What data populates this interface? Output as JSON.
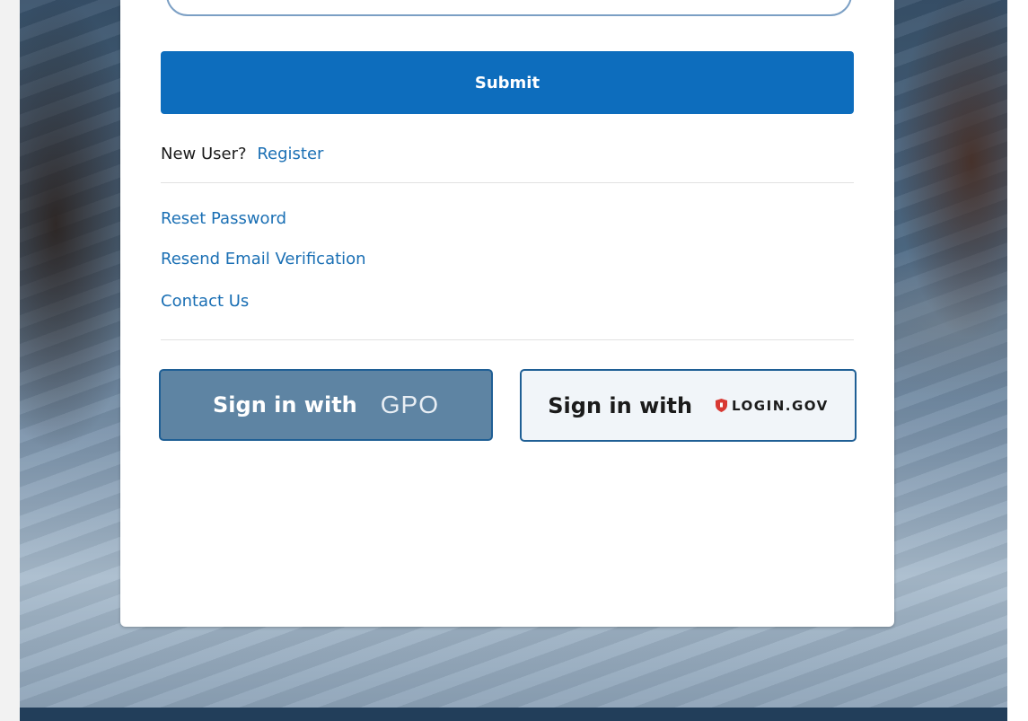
{
  "form": {
    "submit_label": "Submit",
    "new_user_text": "New User?",
    "register_link": "Register"
  },
  "links": {
    "reset_password": "Reset Password",
    "resend_verification": "Resend Email Verification",
    "contact_us": "Contact Us"
  },
  "sso": {
    "gpo": {
      "label": "Sign in with",
      "logo_text": "GPO"
    },
    "logingov": {
      "label": "Sign in with",
      "logo_text": "LOGIN.GOV",
      "logo_icon": "shield-icon"
    }
  },
  "colors": {
    "primary": "#0d6dbd",
    "link": "#1a6fb4",
    "gpo_button": "#5e84a3",
    "logingov_button": "#f1f5f9",
    "logingov_shield": "#d83933",
    "footer": "#223e5a"
  }
}
